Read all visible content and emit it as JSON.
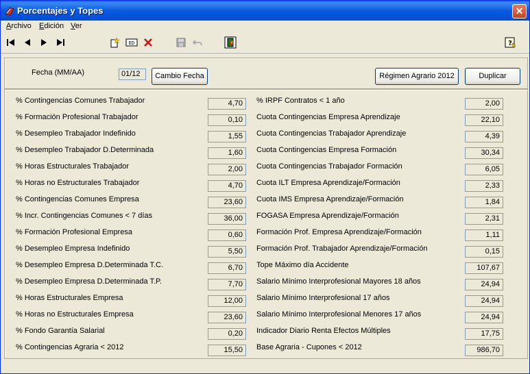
{
  "window": {
    "title": "Porcentajes y Topes"
  },
  "menu": [
    "Archivo",
    "Edición",
    "Ver"
  ],
  "header": {
    "fecha_label": "Fecha (MM/AA)",
    "fecha_value": "01/12",
    "cambio_fecha": "Cambio Fecha",
    "regimen": "Régimen Agrario 2012",
    "duplicar": "Duplicar"
  },
  "left_rows": [
    {
      "label": "% Contingencias Comunes Trabajador",
      "value": "4,70"
    },
    {
      "label": "% Formación Profesional Trabajador",
      "value": "0,10"
    },
    {
      "label": "% Desempleo Trabajador Indefinido",
      "value": "1,55"
    },
    {
      "label": "% Desempleo Trabajador D.Determinada",
      "value": "1,60"
    },
    {
      "label": "% Horas Estructurales Trabajador",
      "value": "2,00"
    },
    {
      "label": "% Horas no Estructurales Trabajador",
      "value": "4,70"
    },
    {
      "label": "% Contingencias Comunes Empresa",
      "value": "23,60"
    },
    {
      "label": "% Incr. Contingencias Comunes < 7 días",
      "value": "36,00"
    },
    {
      "label": "% Formación Profesional Empresa",
      "value": "0,60"
    },
    {
      "label": "% Desempleo Empresa Indefinido",
      "value": "5,50"
    },
    {
      "label": "% Desempleo Empresa D.Determinada T.C.",
      "value": "6,70"
    },
    {
      "label": "% Desempleo Empresa D.Determinada T.P.",
      "value": "7,70"
    },
    {
      "label": "% Horas Estructurales Empresa",
      "value": "12,00"
    },
    {
      "label": "% Horas no Estructurales Empresa",
      "value": "23,60"
    },
    {
      "label": "% Fondo Garantía Salarial",
      "value": "0,20"
    },
    {
      "label": "% Contingencias Agraria < 2012",
      "value": "15,50"
    }
  ],
  "right_rows": [
    {
      "label": "% IRPF Contratos < 1 año",
      "value": "2,00"
    },
    {
      "label": "Cuota Contingencias Empresa Aprendizaje",
      "value": "22,10"
    },
    {
      "label": "Cuota Contingencias Trabajador Aprendizaje",
      "value": "4,39"
    },
    {
      "label": "Cuota Contingencias Empresa Formación",
      "value": "30,34"
    },
    {
      "label": "Cuota Contingencias Trabajador Formación",
      "value": "6,05"
    },
    {
      "label": "Cuota ILT Empresa Aprendizaje/Formación",
      "value": "2,33"
    },
    {
      "label": "Cuota IMS Empresa Aprendizaje/Formación",
      "value": "1,84"
    },
    {
      "label": "FOGASA Empresa Aprendizaje/Formación",
      "value": "2,31"
    },
    {
      "label": "Formación Prof. Empresa Aprendizaje/Formación",
      "value": "1,11"
    },
    {
      "label": "Formación Prof. Trabajador Aprendizaje/Formación",
      "value": "0,15"
    },
    {
      "label": "Tope Máximo día Accidente",
      "value": "107,67"
    },
    {
      "label": "Salario Mínimo Interprofesional Mayores 18 años",
      "value": "24,94"
    },
    {
      "label": "Salario Mínimo Interprofesional  17 años",
      "value": "24,94"
    },
    {
      "label": "Salario Mínimo Interprofesional Menores 17 años",
      "value": "24,94"
    },
    {
      "label": "Indicador Diario Renta Efectos Múltiples",
      "value": "17,75"
    },
    {
      "label": "Base Agraria - Cupones < 2012",
      "value": "986,70"
    }
  ],
  "icons": [
    "first-record-icon",
    "prev-record-icon",
    "next-record-icon",
    "last-record-icon",
    "new-record-icon",
    "edit-record-icon",
    "delete-record-icon",
    "save-icon",
    "undo-icon",
    "exit-icon",
    "help-icon"
  ]
}
